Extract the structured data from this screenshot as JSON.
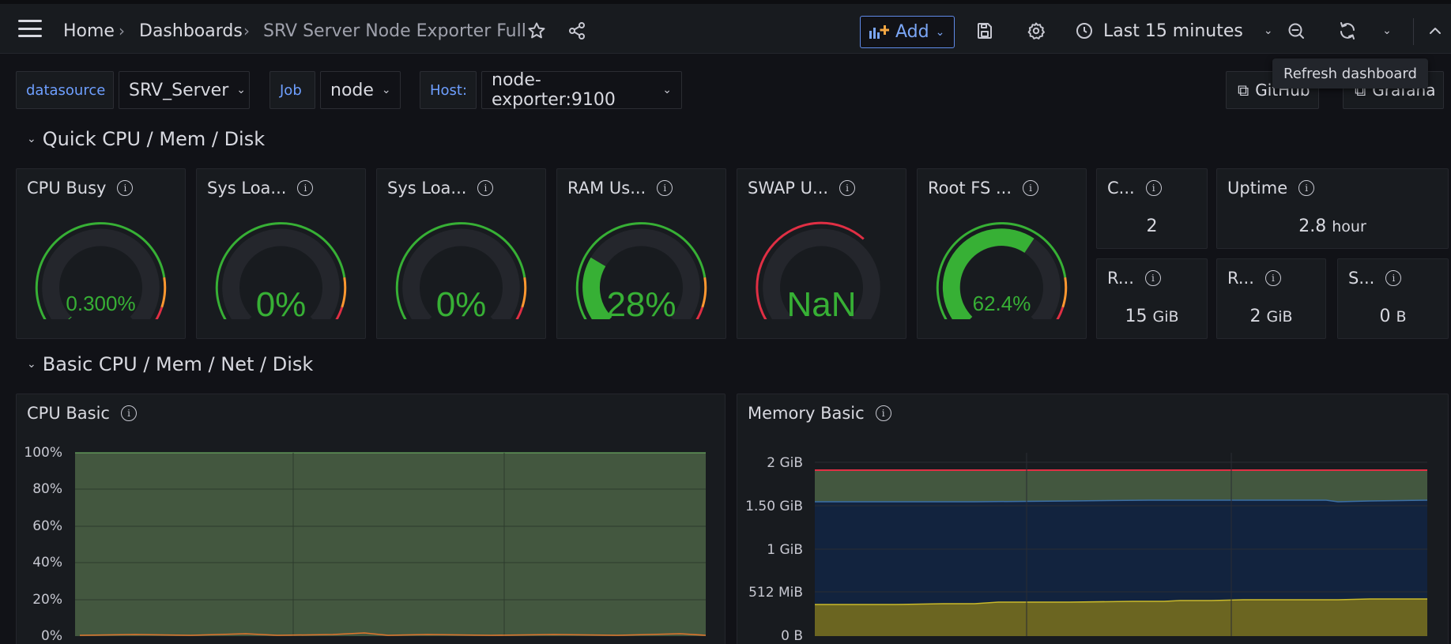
{
  "topbar": {
    "breadcrumbs": [
      "Home",
      "Dashboards",
      "SRV Server Node Exporter Full"
    ],
    "add_label": "Add",
    "time_range": "Last 15 minutes"
  },
  "tooltip": "Refresh dashboard",
  "variables": [
    {
      "label": "datasource",
      "value": "SRV_Server"
    },
    {
      "label": "Job",
      "value": "node"
    },
    {
      "label": "Host:",
      "value": "node-exporter:9100"
    }
  ],
  "links": [
    "GitHub",
    "Grafana"
  ],
  "rows": [
    "Quick CPU / Mem / Disk",
    "Basic CPU / Mem / Net / Disk"
  ],
  "gauges": [
    {
      "title": "CPU Busy",
      "value": "0.300%",
      "fraction": 0.003
    },
    {
      "title": "Sys Loa...",
      "value": "0%",
      "fraction": 0
    },
    {
      "title": "Sys Loa...",
      "value": "0%",
      "fraction": 0
    },
    {
      "title": "RAM Us...",
      "value": "28%",
      "fraction": 0.28
    },
    {
      "title": "SWAP U...",
      "value": "NaN",
      "fraction": 0
    },
    {
      "title": "Root FS ...",
      "value": "62.4%",
      "fraction": 0.624
    }
  ],
  "stats": [
    {
      "title": "C...",
      "value": "2",
      "unit": ""
    },
    {
      "title": "Uptime",
      "value": "2.8",
      "unit": "hour"
    },
    {
      "title": "R...",
      "value": "15",
      "unit": "GiB"
    },
    {
      "title": "R...",
      "value": "2",
      "unit": "GiB"
    },
    {
      "title": "S...",
      "value": "0",
      "unit": "B"
    }
  ],
  "cpu_basic": {
    "title": "CPU Basic",
    "y_ticks": [
      "100%",
      "80%",
      "60%",
      "40%",
      "20%",
      "0%"
    ]
  },
  "memory_basic": {
    "title": "Memory Basic",
    "y_ticks": [
      "2 GiB",
      "1.50 GiB",
      "1 GiB",
      "512 MiB",
      "0 B"
    ]
  },
  "colors": {
    "green": "#37b035",
    "red": "#e02f44",
    "orange": "#ff9830",
    "accent_blue": "#6e9fff"
  }
}
